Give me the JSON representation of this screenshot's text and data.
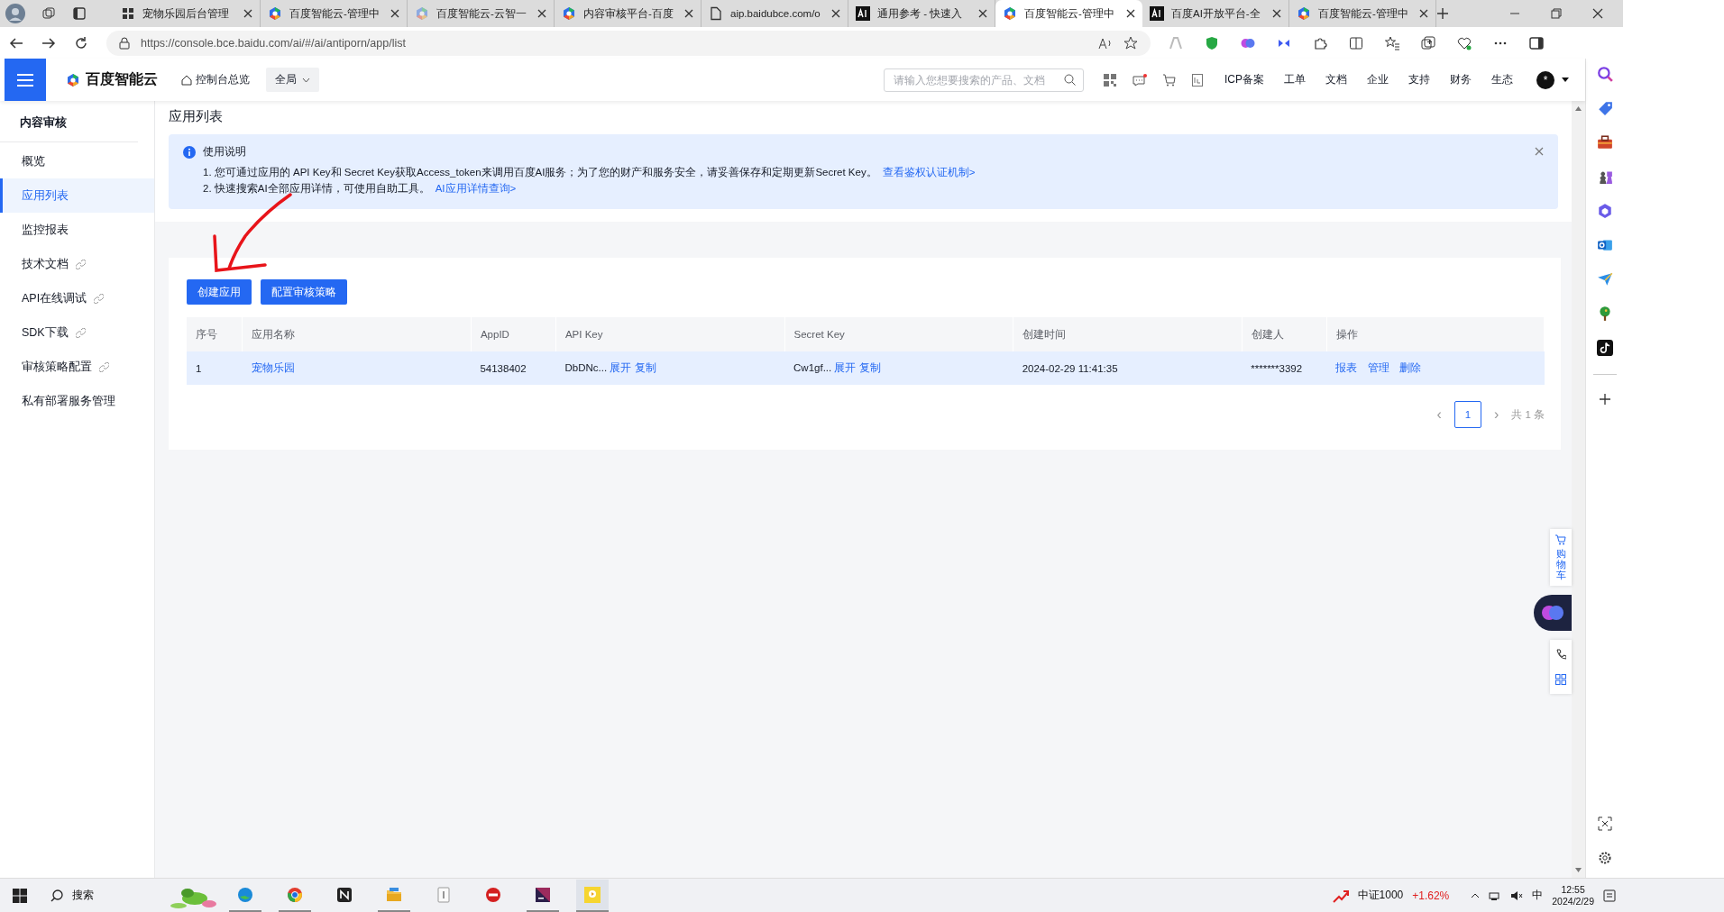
{
  "browser": {
    "tabs": [
      {
        "title": "宠物乐园后台管理",
        "kind": "grid",
        "selected": false
      },
      {
        "title": "百度智能云-管理中",
        "kind": "cloud",
        "selected": false
      },
      {
        "title": "百度智能云-云智一",
        "kind": "cloud-faded",
        "selected": false
      },
      {
        "title": "内容审核平台-百度",
        "kind": "cloud",
        "selected": false
      },
      {
        "title": "aip.baidubce.com/o",
        "kind": "page",
        "selected": false
      },
      {
        "title": "通用参考 - 快速入",
        "kind": "ai",
        "selected": false
      },
      {
        "title": "百度智能云-管理中",
        "kind": "cloud",
        "selected": true
      },
      {
        "title": "百度AI开放平台-全",
        "kind": "ai",
        "selected": false
      },
      {
        "title": "百度智能云-管理中",
        "kind": "cloud",
        "selected": false
      }
    ],
    "url": "https://console.bce.baidu.com/ai/#/ai/antiporn/app/list"
  },
  "header": {
    "logo": "百度智能云",
    "console": "控制台总览",
    "scope": "全局",
    "search": {
      "placeholder": "请输入您想要搜索的产品、文档"
    },
    "nav": [
      "ICP备案",
      "工单",
      "文档",
      "企业",
      "支持",
      "财务",
      "生态"
    ],
    "avatar": "*"
  },
  "sidebar": {
    "title": "内容审核",
    "items": [
      {
        "label": "概览",
        "external": false,
        "selected": false
      },
      {
        "label": "应用列表",
        "external": false,
        "selected": true
      },
      {
        "label": "监控报表",
        "external": false,
        "selected": false
      },
      {
        "label": "技术文档",
        "external": true,
        "selected": false
      },
      {
        "label": "API在线调试",
        "external": true,
        "selected": false
      },
      {
        "label": "SDK下载",
        "external": true,
        "selected": false
      },
      {
        "label": "审核策略配置",
        "external": true,
        "selected": false
      },
      {
        "label": "私有部署服务管理",
        "external": false,
        "selected": false
      }
    ]
  },
  "page": {
    "title": "应用列表",
    "notice": {
      "title": "使用说明",
      "lines": [
        {
          "text": "1. 您可通过应用的 API Key和 Secret Key获取Access_token来调用百度AI服务；为了您的财产和服务安全，请妥善保存和定期更新Secret Key。",
          "link": "查看鉴权认证机制>"
        },
        {
          "text": "2. 快速搜索AI全部应用详情，可使用自助工具。",
          "link": "AI应用详情查询>"
        }
      ]
    },
    "buttons": [
      "创建应用",
      "配置审核策略"
    ],
    "table": {
      "columns": [
        "序号",
        "应用名称",
        "AppID",
        "API Key",
        "Secret Key",
        "创建时间",
        "创建人",
        "操作"
      ],
      "rows": [
        {
          "highlighted": true,
          "index": "1",
          "name": "宠物乐园",
          "app_id": "54138402",
          "api_key": {
            "value": "DbDNc...",
            "links": [
              "展开",
              "复制"
            ]
          },
          "secret_key": {
            "value": "Cw1gf...",
            "links": [
              "展开",
              "复制"
            ]
          },
          "created": "2024-02-29 11:41:35",
          "creator": "*******3392",
          "actions": [
            "报表",
            "管理",
            "删除"
          ]
        }
      ]
    },
    "pagination": {
      "prev": "‹",
      "pages": [
        {
          "label": "1",
          "selected": true
        }
      ],
      "next": "›",
      "total": "共 1 条"
    }
  },
  "float": {
    "cart": "购物车"
  },
  "taskbar": {
    "search": "搜索",
    "stock": {
      "name": "中证1000",
      "change": "+1.62%"
    },
    "ime": "中",
    "time": "12:55",
    "date": "2024/2/29"
  }
}
